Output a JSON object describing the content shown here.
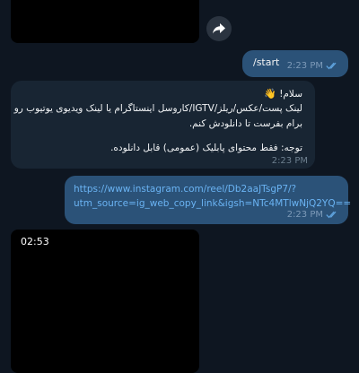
{
  "messages": {
    "top_media": {},
    "start": {
      "text": "/start",
      "time": "2:23 PM"
    },
    "info": {
      "greeting": "سلام!",
      "greeting_emoji": "👋",
      "line1": "لینک پست/عکس/ریلز/IGTV/کاروسل اینستاگرام یا لینک ویدیوی یوتیوب رو",
      "line2": "برام بفرست تا دانلودش کنم.",
      "note": "توجه: فقط محتوای پابلیک (عمومی) قابل دانلوده.",
      "time": "2:23 PM"
    },
    "url": {
      "line1": "https://www.instagram.com/reel/Db2aaJTsgP7/?",
      "line2": "utm_source=ig_web_copy_link&igsh=NTc4MTlwNjQ2YQ==",
      "time": "2:23 PM"
    },
    "video": {
      "duration": "02:53"
    }
  },
  "icons": {
    "forward": "forward-arrow-icon",
    "read": "double-check-icon"
  },
  "colors": {
    "background": "#0e1621",
    "outgoing_bubble": "#2b5278",
    "incoming_bubble": "#182533",
    "link": "#6ab3f3",
    "read_check": "#5fa3de"
  }
}
